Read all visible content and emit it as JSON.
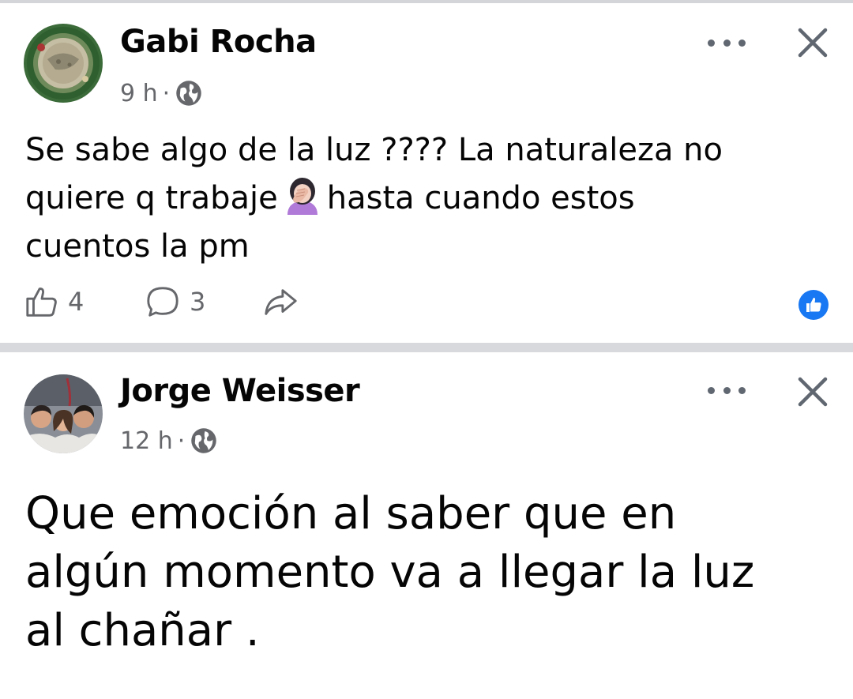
{
  "posts": [
    {
      "author": "Gabi Rocha",
      "time": "9 h",
      "separator": "·",
      "privacy_icon": "globe-icon",
      "text_lines": [
        "Se sabe algo de la luz ???? La naturaleza no",
        "quiere q trabaje",
        "hasta cuando estos",
        "cuentos la pm"
      ],
      "emoji": "woman-facepalming-emoji",
      "likes": "4",
      "comments": "3",
      "reaction_icon": "like-reaction-icon"
    },
    {
      "author": "Jorge Weisser",
      "time": "12 h",
      "separator": "·",
      "privacy_icon": "globe-icon",
      "text_lines": [
        "Que emoción al saber que en",
        "algún momento va a llegar la luz",
        "al chañar ."
      ]
    }
  ],
  "colors": {
    "divider": "#d7d9dc",
    "secondary_text": "#65676b",
    "like_blue": "#1877f2",
    "primary_text": "#050505"
  }
}
